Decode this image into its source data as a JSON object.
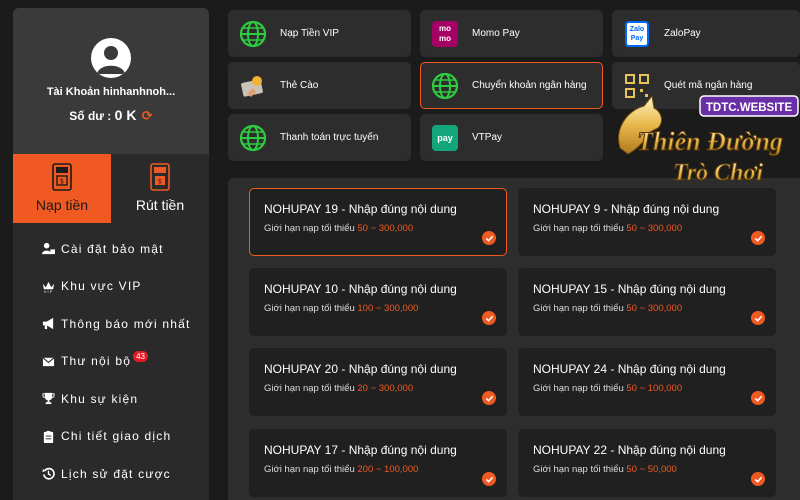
{
  "profile": {
    "account_label": "Tài Khoản hinhanhnoh...",
    "balance_label": "Số dư :",
    "balance_value": "0 K",
    "refresh_glyph": "⟳"
  },
  "tabs": [
    {
      "label": "Nạp tiền",
      "icon": "atm-deposit-icon",
      "active": true
    },
    {
      "label": "Rút tiền",
      "icon": "atm-withdraw-icon",
      "active": false
    }
  ],
  "menu": [
    {
      "label": "Cài đặt bảo mật",
      "icon": "user-lock-icon"
    },
    {
      "label": "Khu vực VIP",
      "icon": "vip-crown-icon"
    },
    {
      "label": "Thông báo mới nhất",
      "icon": "megaphone-icon"
    },
    {
      "label": "Thư nội bộ",
      "icon": "envelope-icon",
      "badge": "43"
    },
    {
      "label": "Khu sự kiện",
      "icon": "trophy-icon"
    },
    {
      "label": "Chi tiết giao dịch",
      "icon": "clipboard-icon"
    },
    {
      "label": "Lịch sử đặt cược",
      "icon": "history-icon"
    }
  ],
  "methods": [
    {
      "label": "Nạp Tiền VIP",
      "icon": "globe-icon"
    },
    {
      "label": "Momo Pay",
      "icon": "momo-icon",
      "icon_text": "mo mo"
    },
    {
      "label": "ZaloPay",
      "icon": "zalopay-icon",
      "icon_text": "Zalo Pay"
    },
    {
      "label": "Thẻ Cào",
      "icon": "scratch-card-icon"
    },
    {
      "label": "Chuyển khoản ngân hàng",
      "icon": "globe-icon",
      "selected": true
    },
    {
      "label": "Quét mã ngân hàng",
      "icon": "qr-code-icon"
    },
    {
      "label": "Thanh toán trực tuyến",
      "icon": "globe-icon"
    },
    {
      "label": "VTPay",
      "icon": "vtpay-icon",
      "icon_text": "pay"
    }
  ],
  "options": [
    {
      "title": "NOHUPAY 19 - Nhập đúng nội dung",
      "limit_label": "Giới hạn nạp tối thiểu",
      "range": "50 ~ 300,000",
      "selected": true
    },
    {
      "title": "NOHUPAY 9 - Nhập đúng nội dung",
      "limit_label": "Giới hạn nạp tối thiểu",
      "range": "50 ~ 300,000"
    },
    {
      "title": "NOHUPAY 10 - Nhập đúng nội dung",
      "limit_label": "Giới hạn nạp tối thiểu",
      "range": "100 ~ 300,000"
    },
    {
      "title": "NOHUPAY 15 - Nhập đúng nội dung",
      "limit_label": "Giới hạn nạp tối thiểu",
      "range": "50 ~ 300,000"
    },
    {
      "title": "NOHUPAY 20 - Nhập đúng nội dung",
      "limit_label": "Giới hạn nạp tối thiểu",
      "range": "20 ~ 300,000"
    },
    {
      "title": "NOHUPAY 24 - Nhập đúng nội dung",
      "limit_label": "Giới hạn nạp tối thiểu",
      "range": "50 ~ 100,000"
    },
    {
      "title": "NOHUPAY 17 - Nhập đúng nội dung",
      "limit_label": "Giới hạn nạp tối thiểu",
      "range": "200 ~ 100,000"
    },
    {
      "title": "NOHUPAY 22 - Nhập đúng nội dung",
      "limit_label": "Giới hạn nạp tối thiểu",
      "range": "50 ~ 50,000"
    }
  ],
  "logo": {
    "site": "TDTC.WEBSITE",
    "line1": "Thiên Đường",
    "line2": "Trò Chơi"
  },
  "colors": {
    "accent": "#f05a22",
    "panel": "#2d2d2d",
    "card": "#202020",
    "globe": "#2ecc40"
  }
}
